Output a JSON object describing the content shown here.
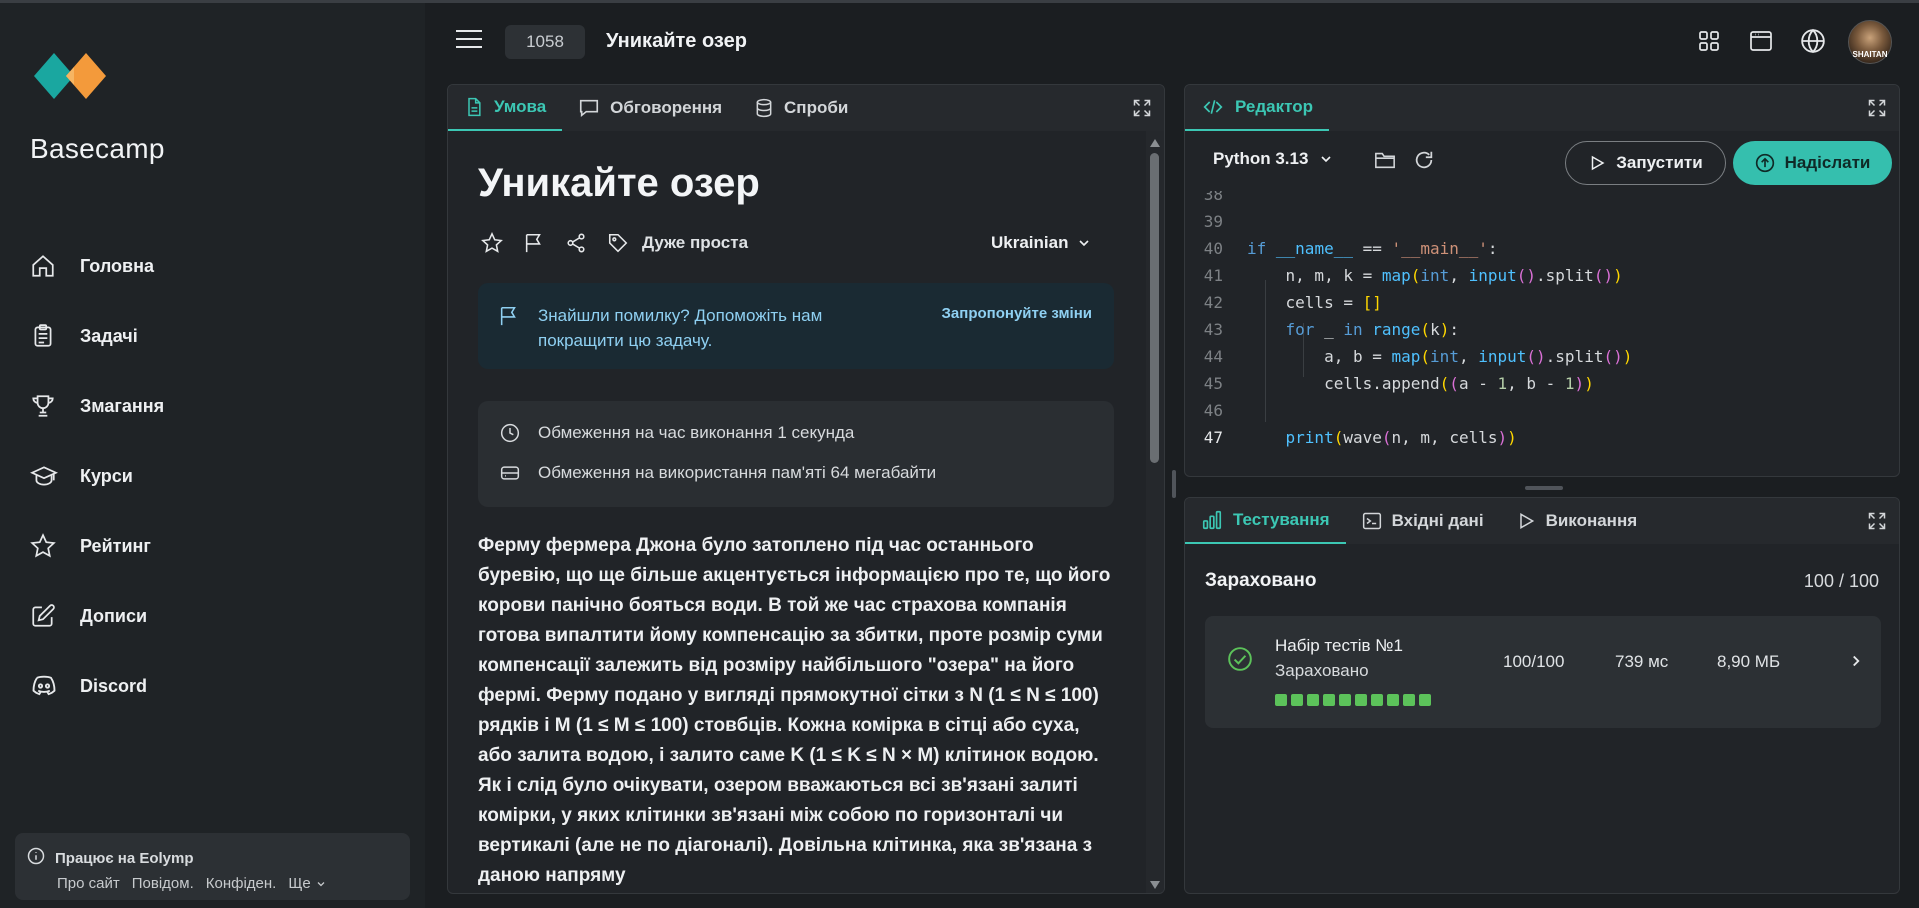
{
  "app": {
    "brand": "Basecamp",
    "problem_number": "1058",
    "page_title": "Уникайте озер",
    "avatar_text": "SHAITAN"
  },
  "sidebar": {
    "items": [
      {
        "label": "Головна",
        "icon": "home-icon"
      },
      {
        "label": "Задачі",
        "icon": "clipboard-icon"
      },
      {
        "label": "Змагання",
        "icon": "trophy-icon"
      },
      {
        "label": "Курси",
        "icon": "graduation-cap-icon"
      },
      {
        "label": "Рейтинг",
        "icon": "star-icon"
      },
      {
        "label": "Дописи",
        "icon": "edit-icon"
      },
      {
        "label": "Discord",
        "icon": "discord-icon"
      }
    ],
    "footer": {
      "powered": "Працює на Eolymp",
      "links": [
        "Про сайт",
        "Повідом.",
        "Конфіден.",
        "Ще"
      ]
    }
  },
  "problem": {
    "tabs": [
      "Умова",
      "Обговорення",
      "Спроби"
    ],
    "title": "Уникайте озер",
    "difficulty": "Дуже проста",
    "language": "Ukrainian",
    "notice_text": "Знайшли помилку? Допоможіть нам покращити цю задачу.",
    "notice_link": "Запропонуйте зміни",
    "time_limit": "Обмеження на час виконання 1 секунда",
    "memory_limit": "Обмеження на використання пам'яті 64 мегабайти",
    "statement": "Ферму фермера Джона було затоплено під час останнього буревію, що ще більше акцентується інформацією про те, що його корови панічно бояться води. В той же час страхова компанія готова випалтити йому компенсацію за збитки, проте розмір суми компенсації залежить від розміру найбільшого \"озера\" на його фермі. Ферму подано у вигляді прямокутної сітки з N (1 ≤ N ≤ 100) рядків і M (1 ≤ M ≤ 100) стовбців. Кожна комірка в сітці або суха, або залита водою, і залито саме K (1 ≤ K ≤ N × M) клітинок водою. Як і слід було очікувати, озером вважаються всі зв'язані залиті комірки, у яких клітинки зв'язані між собою по горизонталі чи вертикалі (але не по діагоналі). Довільна клітинка, яка зв'язана з даною напряму"
  },
  "editor": {
    "tab": "Редактор",
    "language": "Python 3.13",
    "run_label": "Запустити",
    "submit_label": "Надіслати",
    "line_numbers": [
      "38",
      "39",
      "40",
      "41",
      "42",
      "43",
      "44",
      "45",
      "46",
      "47"
    ],
    "code_lines": [
      "",
      "",
      "if __name__ == '__main__':",
      "    n, m, k = map(int, input().split())",
      "    cells = []",
      "    for _ in range(k):",
      "        a, b = map(int, input().split())",
      "        cells.append((a - 1, b - 1))",
      "",
      "    print(wave(n, m, cells))"
    ],
    "accent_color": "#35bfae"
  },
  "testing": {
    "tabs": [
      "Тестування",
      "Вхідні дані",
      "Виконання"
    ],
    "status": "Зараховано",
    "score": "100 / 100",
    "test_set": {
      "name": "Набір тестів №1",
      "status": "Зараховано",
      "score": "100/100",
      "time": "739 мс",
      "memory": "8,90 МБ",
      "passed_tests": 10
    },
    "success_color": "#5cc25a"
  }
}
